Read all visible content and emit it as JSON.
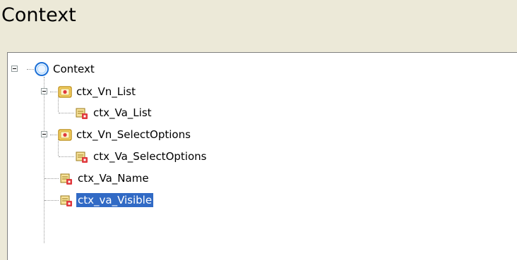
{
  "header": {
    "title": "Context"
  },
  "tree": {
    "root": {
      "label": "Context",
      "icon": "context-circle-icon"
    },
    "nodes": [
      {
        "label": "ctx_Vn_List",
        "icon": "node-folder-icon"
      },
      {
        "label": "ctx_Va_List",
        "icon": "attribute-icon"
      },
      {
        "label": "ctx_Vn_SelectOptions",
        "icon": "node-folder-icon"
      },
      {
        "label": "ctx_Va_SelectOptions",
        "icon": "attribute-icon"
      },
      {
        "label": "ctx_Va_Name",
        "icon": "attribute-icon"
      },
      {
        "label": "ctx_va_Visible",
        "icon": "attribute-icon",
        "selected": true
      }
    ]
  },
  "colors": {
    "background": "#ece9d8",
    "panel": "#ffffff",
    "selection": "#316ac5"
  }
}
